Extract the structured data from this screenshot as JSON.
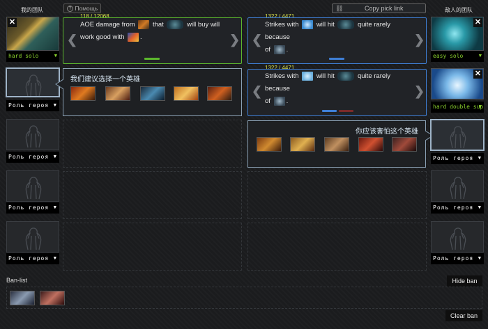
{
  "left_team": {
    "title": "我的团队",
    "slots": [
      {
        "role": "hard solo",
        "has_hero": true
      },
      {
        "role": "Роль героя",
        "has_hero": false
      },
      {
        "role": "Роль героя",
        "has_hero": false
      },
      {
        "role": "Роль героя",
        "has_hero": false
      },
      {
        "role": "Роль героя",
        "has_hero": false
      }
    ]
  },
  "right_team": {
    "title": "敌人的团队",
    "slots": [
      {
        "role": "easy solo",
        "has_hero": true
      },
      {
        "role": "hard double sup",
        "has_hero": true
      },
      {
        "role": "Роль героя",
        "has_hero": false
      },
      {
        "role": "Роль героя",
        "has_hero": false
      },
      {
        "role": "Роль героя",
        "has_hero": false
      }
    ]
  },
  "toolbar": {
    "help_label": "Помощь",
    "copy_label": "Copy pick link"
  },
  "left_tip": {
    "count": "118 / 12068",
    "text_1": "AOE damage from",
    "text_2": "that",
    "text_3": "will buy will",
    "text_4": "work good with",
    "text_5": "."
  },
  "right_tip_1": {
    "count": "1322 / 4471",
    "text_1": "Strikes with",
    "text_2": "will hit",
    "text_3": "quite rarely because",
    "text_4": "of",
    "text_5": "."
  },
  "right_tip_2": {
    "count": "1322 / 4471",
    "text_1": "Strikes with",
    "text_2": "will hit",
    "text_3": "quite rarely because",
    "text_4": "of",
    "text_5": "."
  },
  "suggest_left": {
    "title": "我们建议选择一个英雄",
    "heroes": [
      "hero-1",
      "hero-2",
      "hero-3",
      "hero-4",
      "hero-5"
    ]
  },
  "suggest_right": {
    "title": "你应该害怕这个英雄",
    "heroes": [
      "hero-6",
      "hero-7",
      "hero-8",
      "hero-9",
      "hero-10"
    ]
  },
  "ban": {
    "label": "Ban-list",
    "hide_label": "Hide ban",
    "clear_label": "Clear ban",
    "heroes": [
      "ban-hero-1",
      "ban-hero-2"
    ]
  },
  "colors": {
    "accent_green": "#5cb82d",
    "accent_blue": "#3f7fd6",
    "count_yellow": "#d7e04a",
    "role_green": "#8ad12d"
  },
  "icons": {
    "close": "close-icon",
    "prev": "chevron-left-icon",
    "next": "chevron-right-icon",
    "help": "question-icon",
    "link": "link-icon",
    "dropdown": "triangle-down-icon"
  }
}
